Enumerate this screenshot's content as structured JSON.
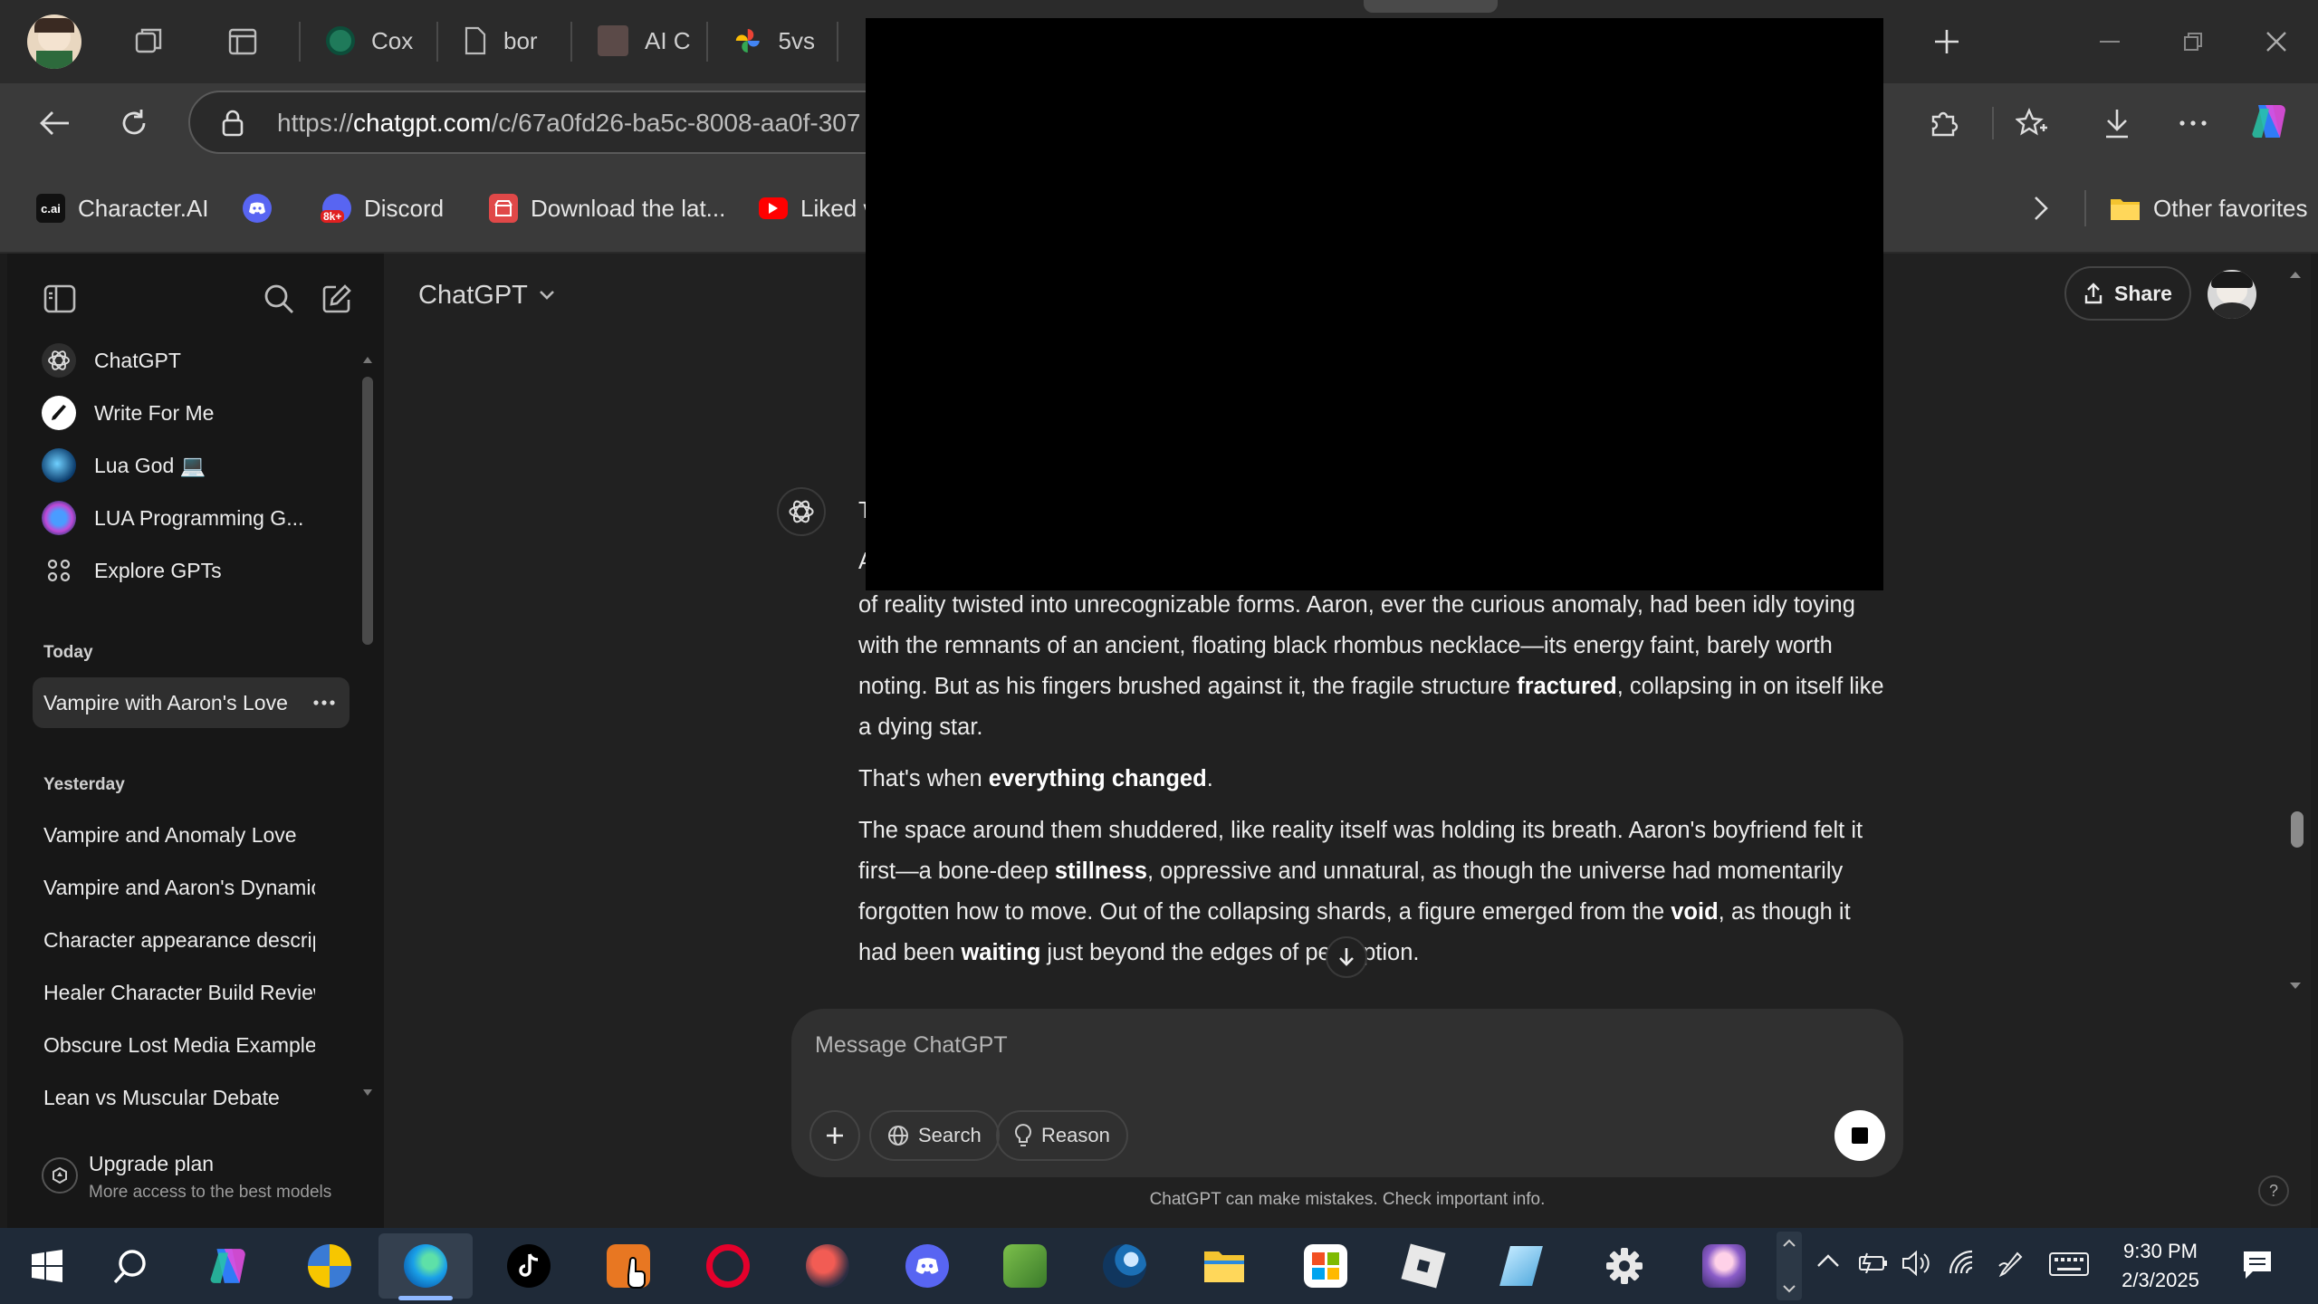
{
  "browser": {
    "tabs": [
      {
        "label": "Cox"
      },
      {
        "label": "bor"
      },
      {
        "label": "AI C"
      },
      {
        "label": "5vs"
      }
    ],
    "url_prefix": "https://",
    "url_host": "chatgpt.com",
    "url_path": "/c/67a0fd26-ba5c-8008-aa0f-307",
    "favorites": [
      {
        "label": "Character.AI",
        "icon": "c.ai"
      },
      {
        "label": "",
        "icon": "discord-icon"
      },
      {
        "label": "Discord",
        "icon": "8k+"
      },
      {
        "label": "Download the lat...",
        "icon": "store-icon"
      },
      {
        "label": "Liked v",
        "icon": "youtube-icon"
      }
    ],
    "other_favorites": "Other favorites"
  },
  "sidebar": {
    "gpts": [
      {
        "label": "ChatGPT"
      },
      {
        "label": "Write For Me"
      },
      {
        "label": "Lua God 💻"
      },
      {
        "label": "LUA Programming G..."
      },
      {
        "label": "Explore GPTs"
      }
    ],
    "today_heading": "Today",
    "today": [
      {
        "label": "Vampire with Aaron's Love"
      }
    ],
    "yesterday_heading": "Yesterday",
    "yesterday": [
      {
        "label": "Vampire and Anomaly Love"
      },
      {
        "label": "Vampire and Aaron's Dynamic"
      },
      {
        "label": "Character appearance descrip"
      },
      {
        "label": "Healer Character Build Review"
      },
      {
        "label": "Obscure Lost Media Examples"
      },
      {
        "label": "Lean vs Muscular Debate"
      }
    ],
    "upgrade_title": "Upgrade plan",
    "upgrade_sub": "More access to the best models"
  },
  "header": {
    "model": "ChatGPT",
    "share": "Share"
  },
  "message": {
    "partial_line_1": "T",
    "partial_line_2": "A",
    "p1_a": "of reality twisted into unrecognizable forms. Aaron, ever the curious anomaly, had been idly toying with the remnants of an ancient, floating black rhombus necklace—its energy faint, barely worth noting. But as his fingers brushed against it, the fragile structure ",
    "p1_b": "fractured",
    "p1_c": ", collapsing in on itself like a dying star.",
    "p2_a": "That's when ",
    "p2_b": "everything changed",
    "p2_c": ".",
    "p3_a": "The space around them shuddered, like reality itself was holding its breath. Aaron's boyfriend felt it first—a bone-deep ",
    "p3_b": "stillness",
    "p3_c": ", oppressive and unnatural, as though the universe had momentarily forgotten how to move. Out of the collapsing shards, a figure emerged from the ",
    "p3_d": "void",
    "p3_e": ", as though it had been ",
    "p3_f": "waiting",
    "p3_g": " just beyond the edges of perception."
  },
  "composer": {
    "placeholder": "Message ChatGPT",
    "search": "Search",
    "reason": "Reason"
  },
  "disclaimer": "ChatGPT can make mistakes. Check important info.",
  "help": "?",
  "taskbar": {
    "time": "9:30 PM",
    "date": "2/3/2025"
  },
  "colors": {
    "sidebar_bg": "#171717",
    "main_bg": "#212121",
    "composer_bg": "#303030",
    "taskbar_bg": "#1f2a38",
    "edge_blue": "#1aa0e8"
  }
}
